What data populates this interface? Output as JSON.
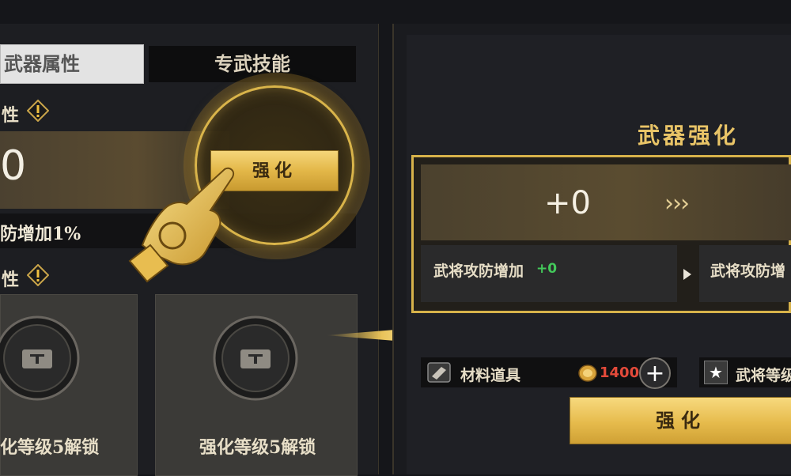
{
  "left": {
    "tab_attr": "武器属性",
    "tab_skill": "专武技能",
    "section1_label": "性",
    "value": "0",
    "enhance_button": "强化",
    "defense_text": "防增加1%",
    "section2_label": "性",
    "cards": [
      {
        "label": "化等级5解锁"
      },
      {
        "label": "强化等级5解锁"
      }
    ]
  },
  "right": {
    "title": "武器强化",
    "level_current": "+0",
    "arrows": "›››",
    "stat_label": "武将攻防增加",
    "stat_bonus": "+0",
    "stat_label_next": "武将攻防增",
    "material_label": "材料道具",
    "coin_value": "1400",
    "plus_label": "+",
    "level_req_label": "武将等级",
    "enhance_button": "强化"
  },
  "colors": {
    "gold": "#e3b748",
    "bonus_green": "#43c85a",
    "cost_red": "#e34a3a"
  },
  "icons": [
    "warning-icon",
    "lock-icon",
    "hand-pointer-icon",
    "arrow-right-icon",
    "material-icon",
    "coin-icon",
    "plus-icon",
    "star-icon",
    "play-icon"
  ]
}
